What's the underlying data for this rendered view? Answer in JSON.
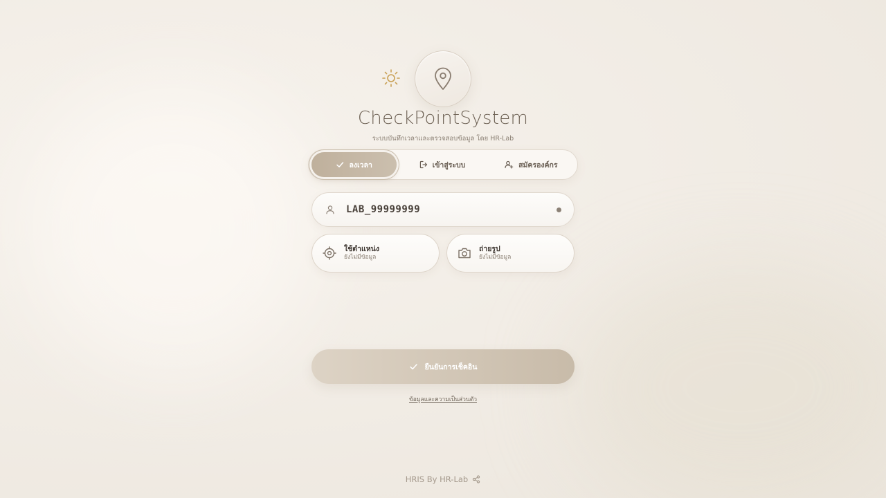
{
  "brand": {
    "title": "CheckPointSystem",
    "subtitle": "ระบบบันทึกเวลาและตรวจสอบข้อมูล โดย HR-Lab"
  },
  "tabs": [
    {
      "label": "ลงเวลา",
      "icon": "check-icon",
      "active": true
    },
    {
      "label": "เข้าสู่ระบบ",
      "icon": "login-icon",
      "active": false
    },
    {
      "label": "สมัครองค์กร",
      "icon": "user-plus-icon",
      "active": false
    }
  ],
  "user_field": {
    "value": "LAB_99999999",
    "icon": "user-icon"
  },
  "actions": [
    {
      "title": "ใช้ตำแหน่ง",
      "status": "ยังไม่มีข้อมูล",
      "icon": "location-target-icon"
    },
    {
      "title": "ถ่ายรูป",
      "status": "ยังไม่มีข้อมูล",
      "icon": "camera-icon"
    }
  ],
  "confirm": {
    "label": "ยืนยันการเช็คอิน"
  },
  "privacy_link": "ข้อมูลและความเป็นส่วนตัว",
  "footer": {
    "text": "HRIS By HR-Lab"
  },
  "colors": {
    "accent": "#c4b6a3",
    "sun": "#c9a054",
    "background": "#f2ede6"
  }
}
